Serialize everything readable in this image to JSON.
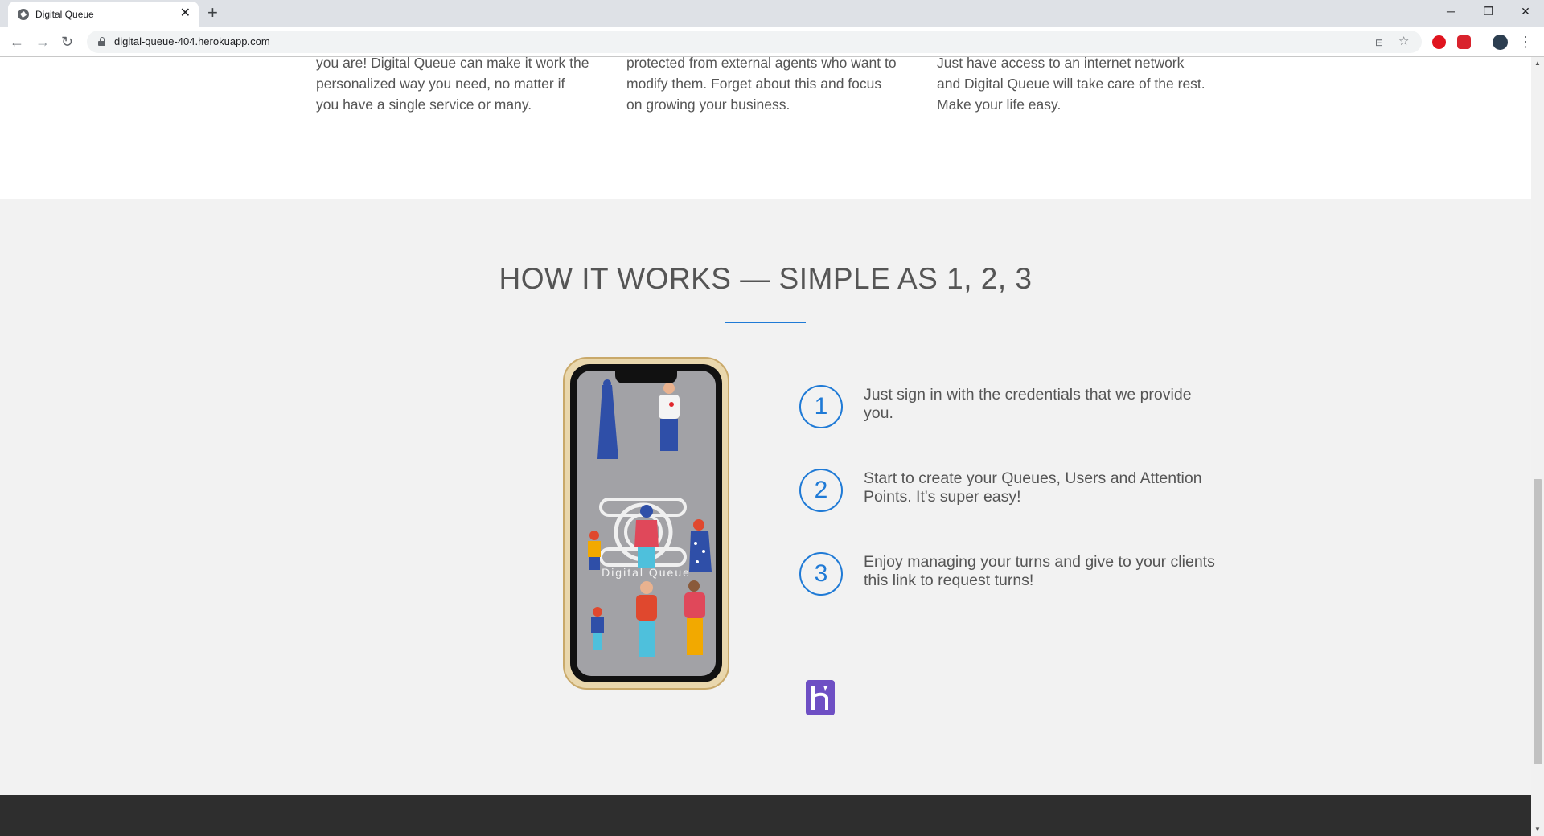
{
  "browser": {
    "tab_title": "Digital Queue",
    "tab_close": "✕",
    "new_tab": "+",
    "url": "digital-queue-404.herokuapp.com",
    "window": {
      "minimize": "─",
      "restore": "❐",
      "close": "✕"
    }
  },
  "features": [
    {
      "text": "you are! Digital Queue can make it work the personalized way you need, no matter if you have a single service or many."
    },
    {
      "text": "protected from external agents who want to modify them. Forget about this and focus on growing your business."
    },
    {
      "text": "Just have access to an internet network and Digital Queue will take care of the rest. Make your life easy."
    }
  ],
  "how_it_works": {
    "title": "HOW IT WORKS — SIMPLE AS 1, 2, 3",
    "phone_logo_text": "Digital Queue",
    "steps": [
      {
        "number": "1",
        "text": "Just sign in with the credentials that we provide you."
      },
      {
        "number": "2",
        "text": "Start to create your Queues, Users and Attention Points. It's super easy!"
      },
      {
        "number": "3",
        "text": "Enjoy managing your turns and give to your clients this link to request turns!"
      }
    ]
  },
  "colors": {
    "accent": "#1f7ad6",
    "section_bg": "#f2f2f2",
    "footer_bg": "#2e2e2e",
    "heroku": "#6e4fc4"
  },
  "icons": [
    "back-arrow-icon",
    "forward-arrow-icon",
    "reload-icon",
    "lock-icon",
    "star-icon",
    "heroku-logo-icon",
    "menu-dots-icon"
  ]
}
